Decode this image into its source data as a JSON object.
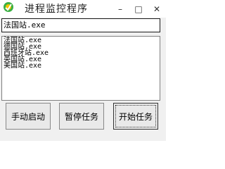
{
  "window": {
    "title": "进程监控程序",
    "minimize_glyph": "–",
    "maximize_glyph": "□",
    "close_glyph": "✕"
  },
  "process_input": {
    "value": "法国站.exe"
  },
  "process_list": {
    "items": [
      {
        "label": "法国站.exe"
      },
      {
        "label": "德国站.exe"
      },
      {
        "label": "西班牙站.exe"
      },
      {
        "label": "英国站.exe"
      },
      {
        "label": "美国站.exe"
      }
    ]
  },
  "buttons": {
    "manual_start_label": "手动启动",
    "pause_label": "暂停任务",
    "start_label": "开始任务"
  },
  "colors": {
    "icon_green": "#3cb043",
    "icon_yellow": "#f5c400"
  }
}
